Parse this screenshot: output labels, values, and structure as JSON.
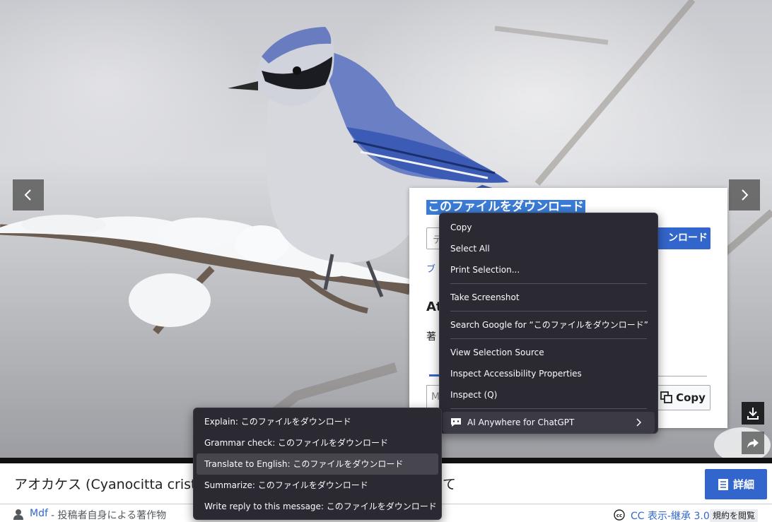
{
  "dialog": {
    "title": "このファイルをダウンロード",
    "input_value": "デ",
    "download_button": "ンロード",
    "link_text": "ブ",
    "attribution_heading": "At",
    "attribution_text": "著",
    "attribution_input": "M",
    "copy_button": "Copy"
  },
  "context_menu": {
    "items": [
      "Copy",
      "Select All",
      "Print Selection...",
      "Take Screenshot",
      "Search Google for “このファイルをダウンロード”",
      "View Selection Source",
      "Inspect Accessibility Properties",
      "Inspect (Q)",
      "AI Anywhere for ChatGPT"
    ]
  },
  "submenu": {
    "items": [
      "Explain: このファイルをダウンロード",
      "Grammar check: このファイルをダウンロード",
      "Translate to English: このファイルをダウンロード",
      "Summarize: このファイルをダウンロード",
      "Write reply to this message: このファイルをダウンロード"
    ],
    "highlighted_index": 2
  },
  "caption": {
    "text": "アオカケス (Cyanocitta crist",
    "text_tail": "て",
    "details_button": "詳細"
  },
  "credit": {
    "author": "Mdf",
    "author_suffix": " - 投稿者自身による著作物",
    "license": "CC 表示-継承 3.0",
    "terms_button": "規約を閲覧"
  },
  "colors": {
    "accent": "#3366cc",
    "menu_bg": "#2b2a33",
    "selection": "#3a7bd5"
  },
  "icons": [
    "chevron-left-icon",
    "chevron-right-icon",
    "download-icon",
    "share-icon",
    "copy-icon",
    "book-icon",
    "user-icon",
    "cc-license-icon",
    "ai-chat-icon",
    "submenu-arrow-icon"
  ]
}
